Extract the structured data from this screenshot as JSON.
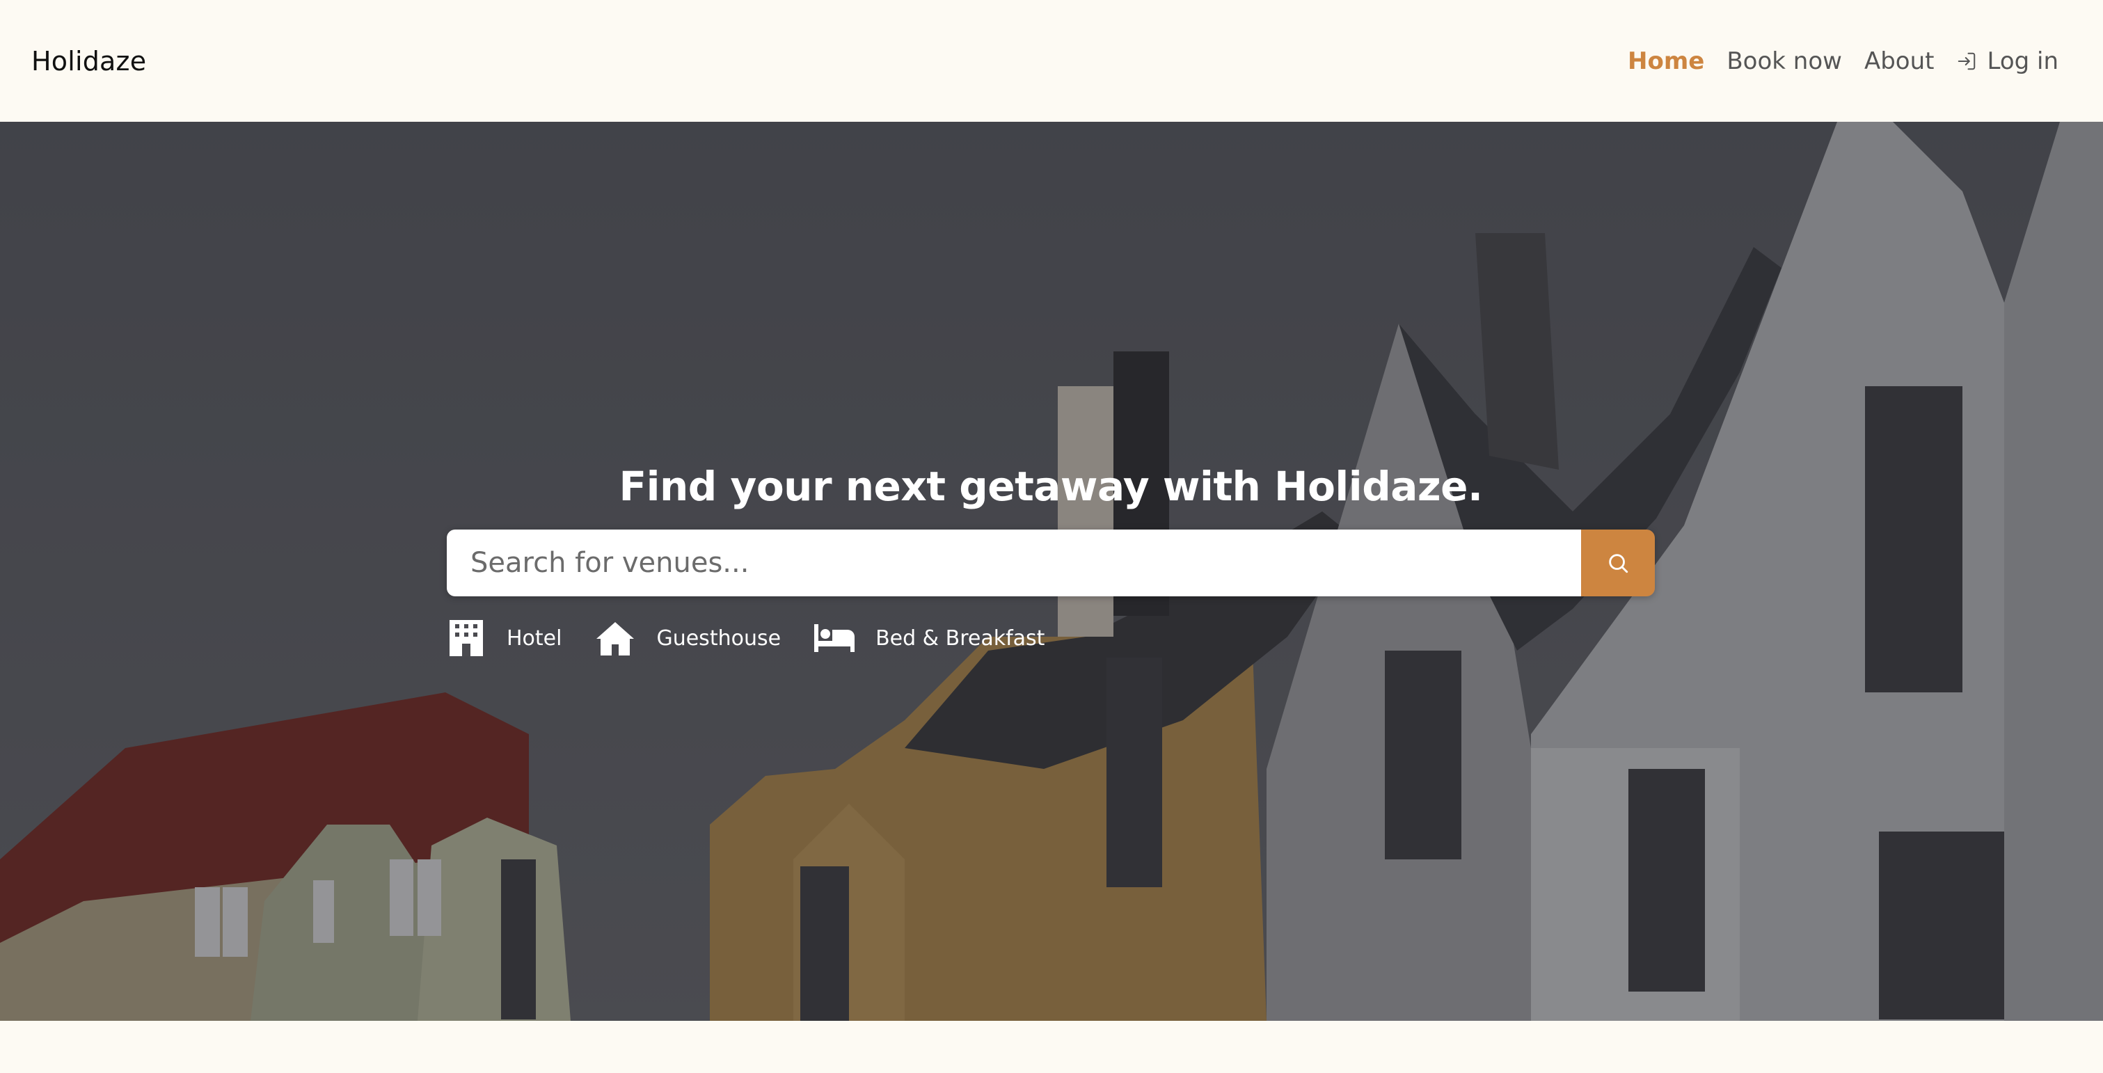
{
  "brand": {
    "name": "Holidaze"
  },
  "nav": {
    "home": "Home",
    "book_now": "Book now",
    "about": "About",
    "login": "Log in"
  },
  "hero": {
    "title": "Find your next getaway with Holidaze.",
    "search_placeholder": "Search for venues...",
    "search_icon": "search-icon",
    "categories": [
      {
        "label": "Hotel",
        "icon": "hotel-icon"
      },
      {
        "label": "Guesthouse",
        "icon": "house-icon"
      },
      {
        "label": "Bed & Breakfast",
        "icon": "bed-icon"
      }
    ]
  },
  "colors": {
    "accent": "#cd8540",
    "background": "#fdfaf3",
    "nav_text": "#555555"
  }
}
